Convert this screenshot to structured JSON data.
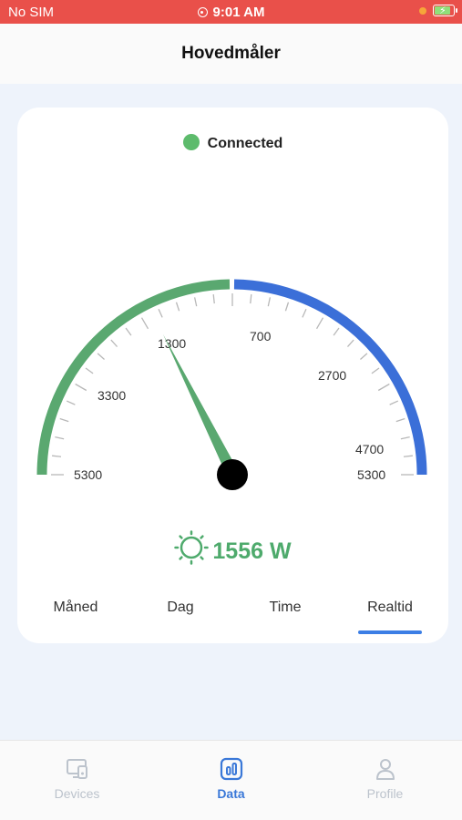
{
  "status_bar": {
    "carrier": "No SIM",
    "time": "9:01 AM"
  },
  "header": {
    "title": "Hovedmåler"
  },
  "connection": {
    "status": "Connected",
    "color": "#5dbb6c"
  },
  "gauge": {
    "left_labels": [
      "5300",
      "3300",
      "1300"
    ],
    "right_labels": [
      "700",
      "2700",
      "4700",
      "5300"
    ],
    "consumption_color": "#5aa870",
    "production_color": "#3b6fd8",
    "needle_color": "#5aa870"
  },
  "power": {
    "value": "1556 W",
    "icon": "sun-icon"
  },
  "tabs": [
    {
      "label": "Måned"
    },
    {
      "label": "Dag"
    },
    {
      "label": "Time"
    },
    {
      "label": "Realtid",
      "active": true
    }
  ],
  "bottom_nav": [
    {
      "label": "Devices",
      "icon": "devices-icon"
    },
    {
      "label": "Data",
      "icon": "data-icon",
      "active": true
    },
    {
      "label": "Profile",
      "icon": "profile-icon"
    }
  ],
  "colors": {
    "accent": "#3a78d8",
    "status_bar": "#e9504a",
    "green": "#4eaa6c"
  }
}
